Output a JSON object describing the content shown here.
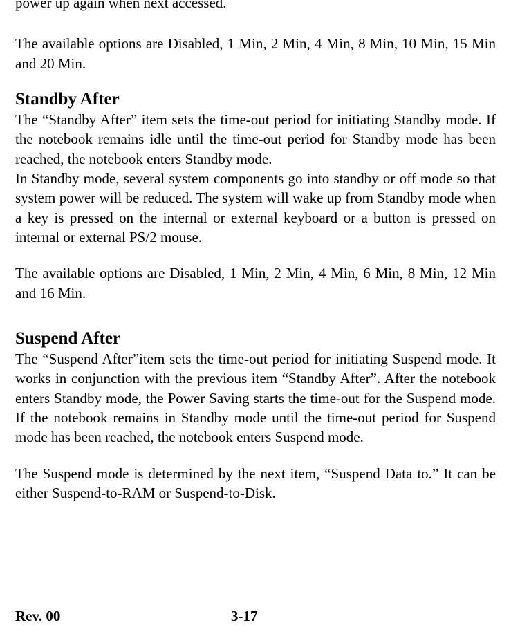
{
  "cut_line": "power up again when next accessed.",
  "para1": "The available options are Disabled, 1 Min, 2 Min, 4 Min, 8 Min, 10 Min, 15 Min and 20 Min.",
  "standby": {
    "heading": "Standby After",
    "p1": "The “Standby After” item sets the time-out period for initiating Standby mode. If the notebook remains idle until the time-out period for Standby mode has been reached, the notebook enters Standby mode.",
    "p2": "In Standby mode, several system components go into standby or off mode so that system power will be reduced. The system will wake up from Standby mode when a key is pressed on the internal or external keyboard or a button is pressed on internal or external PS/2 mouse.",
    "p3": "The available options are Disabled, 1 Min, 2 Min, 4 Min, 6 Min, 8 Min, 12 Min and 16 Min."
  },
  "suspend": {
    "heading": "Suspend After",
    "p1": "The “Suspend After”item sets the time-out period for initiating Suspend mode. It works in conjunction with the previous item “Standby After”. After the notebook enters Standby mode, the Power Saving starts the time-out for the Suspend mode. If the notebook remains in Standby mode until the time-out period for Suspend mode has been reached, the notebook enters Suspend mode.",
    "p2": "The Suspend mode is determined by the next item, “Suspend Data to.” It can be either Suspend-to-RAM or Suspend-to-Disk."
  },
  "footer": {
    "rev": "Rev. 00",
    "page": "3-17"
  }
}
